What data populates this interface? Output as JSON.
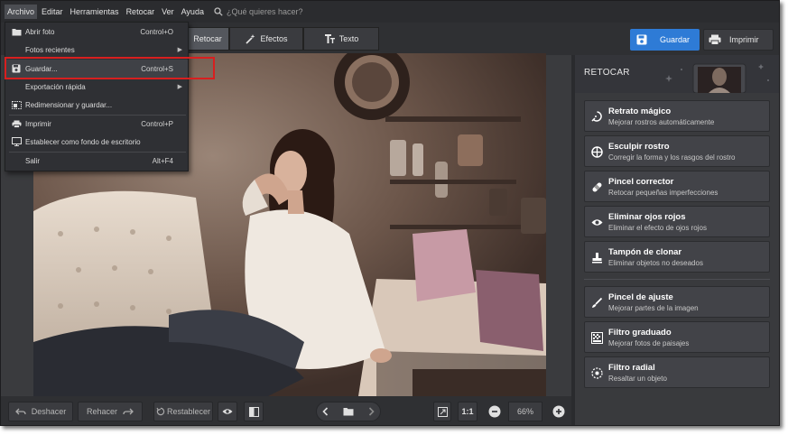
{
  "menubar": {
    "items": [
      "Archivo",
      "Editar",
      "Herramientas",
      "Retocar",
      "Ver",
      "Ayuda"
    ],
    "search_placeholder": "¿Qué quieres hacer?"
  },
  "file_menu": {
    "items": [
      {
        "label": "Abrir foto",
        "shortcut": "Control+O",
        "icon": "folder-icon",
        "submenu": false
      },
      {
        "label": "Fotos recientes",
        "shortcut": "",
        "icon": "",
        "submenu": true
      },
      {
        "label": "Guardar...",
        "shortcut": "Control+S",
        "icon": "save-icon",
        "submenu": false,
        "highlighted": true
      },
      {
        "label": "Exportación rápida",
        "shortcut": "",
        "icon": "",
        "submenu": true
      },
      {
        "label": "Redimensionar y guardar...",
        "shortcut": "",
        "icon": "resize-icon",
        "submenu": false
      },
      {
        "label": "Imprimir",
        "shortcut": "Control+P",
        "icon": "printer-icon",
        "submenu": false
      },
      {
        "label": "Establecer como fondo de escritorio",
        "shortcut": "",
        "icon": "monitor-icon",
        "submenu": false
      },
      {
        "label": "Salir",
        "shortcut": "Alt+F4",
        "icon": "",
        "submenu": false
      }
    ]
  },
  "toolbar": {
    "tabs": [
      {
        "label": "Retocar",
        "active": true
      },
      {
        "label": "Efectos",
        "active": false
      },
      {
        "label": "Texto",
        "active": false
      }
    ],
    "save_label": "Guardar",
    "print_label": "Imprimir"
  },
  "panel": {
    "title": "RETOCAR",
    "tools": [
      {
        "title": "Retrato mágico",
        "desc": "Mejorar rostros automáticamente",
        "icon": "magic-face-icon"
      },
      {
        "title": "Esculpir rostro",
        "desc": "Corregir la forma y los rasgos del rostro",
        "icon": "face-sculpt-icon"
      },
      {
        "title": "Pincel corrector",
        "desc": "Retocar pequeñas imperfecciones",
        "icon": "bandage-icon"
      },
      {
        "title": "Eliminar ojos rojos",
        "desc": "Eliminar el efecto de ojos rojos",
        "icon": "eye-icon"
      },
      {
        "title": "Tampón de clonar",
        "desc": "Eliminar objetos no deseados",
        "icon": "stamp-icon"
      },
      {
        "title": "Pincel de ajuste",
        "desc": "Mejorar partes de la imagen",
        "icon": "brush-icon"
      },
      {
        "title": "Filtro graduado",
        "desc": "Mejorar fotos de paisajes",
        "icon": "gradient-icon"
      },
      {
        "title": "Filtro radial",
        "desc": "Resaltar un objeto",
        "icon": "radial-icon"
      }
    ]
  },
  "bottombar": {
    "undo_label": "Deshacer",
    "redo_label": "Rehacer",
    "reset_label": "Restablecer",
    "ratio_label": "1:1",
    "zoom_value": "66%"
  },
  "colors": {
    "accent": "#2e7bd6",
    "highlight_box": "#d81f1f"
  }
}
